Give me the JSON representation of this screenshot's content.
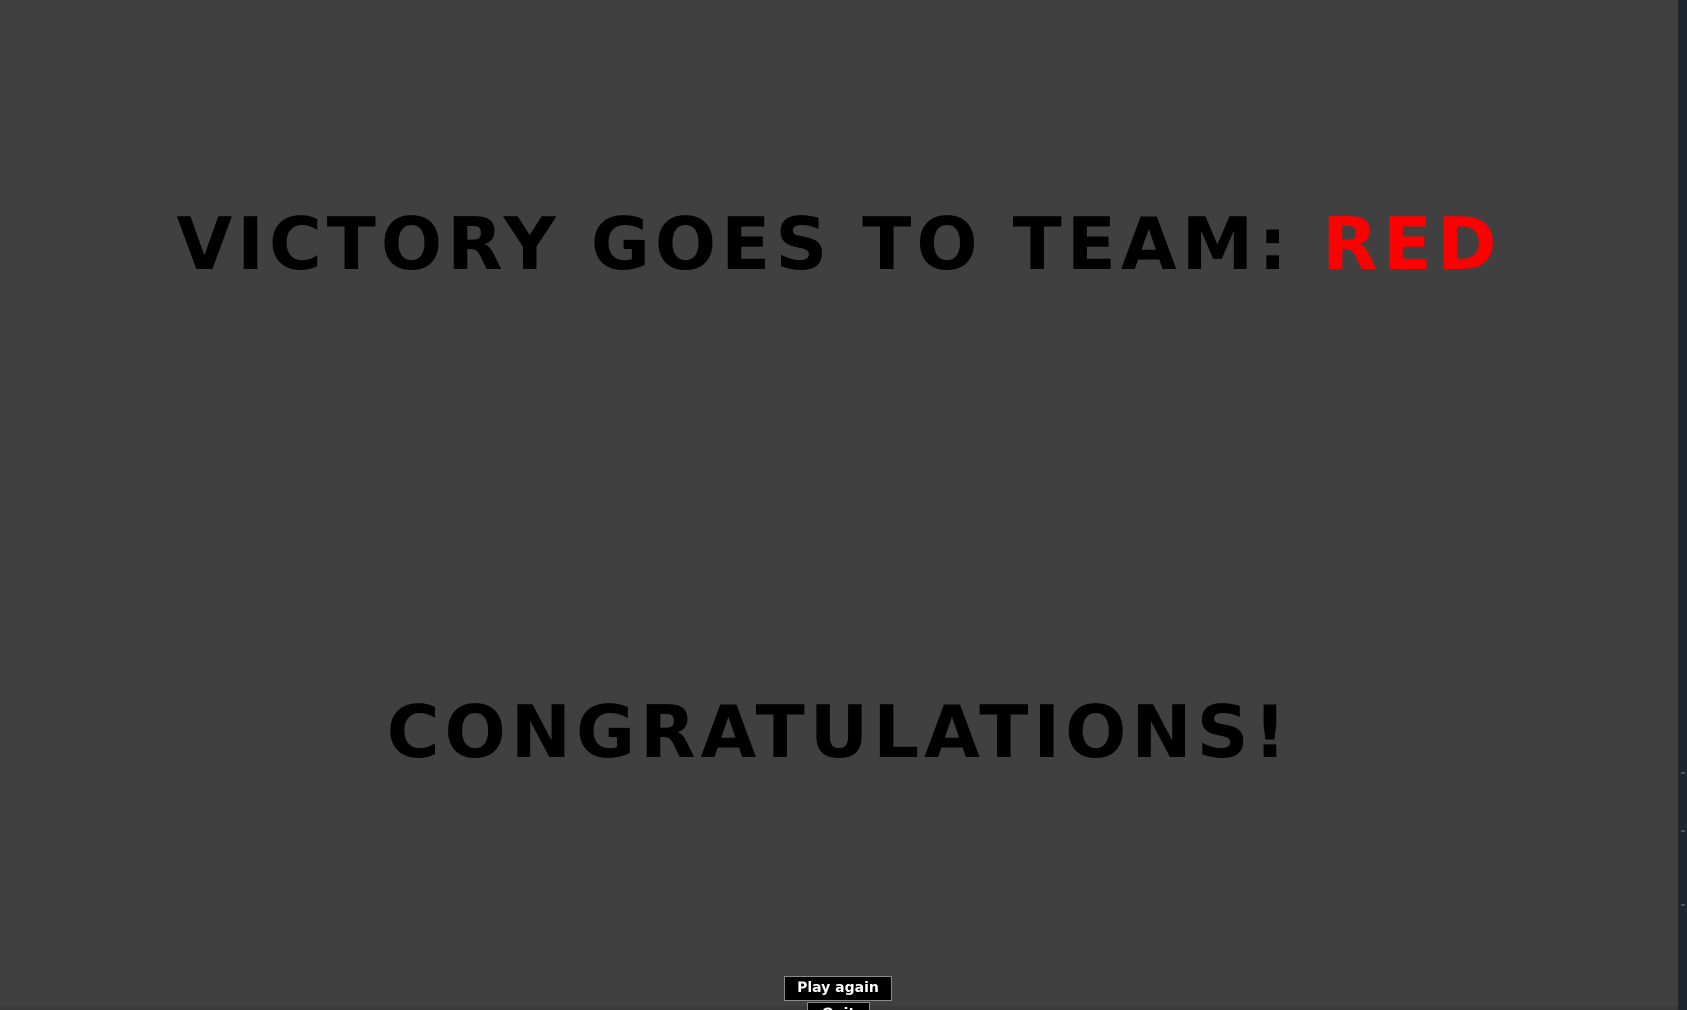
{
  "screen": {
    "background_color": "#404040",
    "text_color": "#000000",
    "team_color": "#ff0000"
  },
  "headline": {
    "prefix": "VICTORY GOES TO TEAM: ",
    "team": "RED"
  },
  "message": "CONGRATULATIONS!",
  "buttons": {
    "play_again": "Play again",
    "quit": "Quit"
  }
}
